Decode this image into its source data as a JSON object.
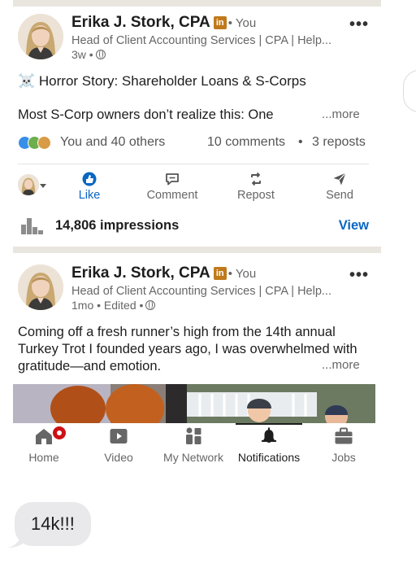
{
  "colors": {
    "linkedin_blue": "#0a66c2",
    "notification_red": "#cc1016",
    "badge_gold": "#c07a1b",
    "divider": "#e9e5df",
    "bubble_gray": "#e9e9eb"
  },
  "posts": [
    {
      "author_name": "Erika J. Stork, CPA",
      "badge_letter": "in",
      "relationship": "• You",
      "headline": "Head of Client Accounting Services | CPA | Help...",
      "meta": "3w •",
      "title": "☠️ Horror Story: Shareholder Loans & S-Corps",
      "body": "Most S-Corp owners don’t realize this: One",
      "more_label": "...more",
      "reactions_text": "You and 40 others",
      "comments_text": "10 comments",
      "separator": "•",
      "reposts_text": "3 reposts",
      "impressions_text": "14,806 impressions",
      "view_label": "View"
    },
    {
      "author_name": "Erika J. Stork, CPA",
      "badge_letter": "in",
      "relationship": "• You",
      "headline": "Head of Client Accounting Services | CPA | Help...",
      "meta": "1mo • Edited •",
      "body_lines": [
        "Coming off a fresh runner’s high from the 14th annual",
        "Turkey Trot I founded years ago, I was overwhelmed with",
        "gratitude—and emotion."
      ],
      "more_label": "...more"
    }
  ],
  "actions": [
    {
      "label": "Like",
      "icon": "like-icon",
      "active": true
    },
    {
      "label": "Comment",
      "icon": "comment-icon"
    },
    {
      "label": "Repost",
      "icon": "repost-icon"
    },
    {
      "label": "Send",
      "icon": "send-icon"
    }
  ],
  "bottom_nav": [
    {
      "label": "Home",
      "icon": "home-icon",
      "badge": true
    },
    {
      "label": "Video",
      "icon": "video-icon"
    },
    {
      "label": "My Network",
      "icon": "network-icon"
    },
    {
      "label": "Notifications",
      "icon": "bell-icon",
      "active": true
    },
    {
      "label": "Jobs",
      "icon": "briefcase-icon"
    }
  ],
  "message": {
    "text": "14k!!!"
  }
}
